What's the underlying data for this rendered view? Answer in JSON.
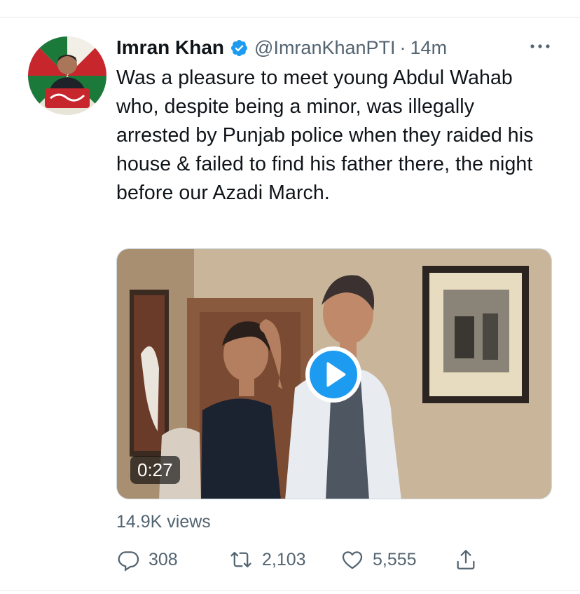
{
  "tweet": {
    "display_name": "Imran Khan",
    "handle": "@ImranKhanPTI",
    "separator": "·",
    "timestamp": "14m",
    "text": "Was a pleasure to meet young Abdul Wahab who, despite being a minor, was illegally arrested by Punjab police when they raided his house & failed to find his father there, the night before our Azadi March.",
    "avatar_icon": "profile-photo",
    "verified_icon": "verified-badge-icon"
  },
  "media": {
    "type": "video",
    "duration": "0:27",
    "play_icon": "play-icon"
  },
  "views": "14.9K views",
  "actions": {
    "reply_count": "308",
    "retweet_count": "2,103",
    "like_count": "5,555",
    "reply_icon": "reply-icon",
    "retweet_icon": "retweet-icon",
    "like_icon": "heart-icon",
    "share_icon": "share-icon"
  },
  "colors": {
    "accent": "#1d9bf0",
    "text": "#0f1419",
    "secondary": "#536471"
  }
}
